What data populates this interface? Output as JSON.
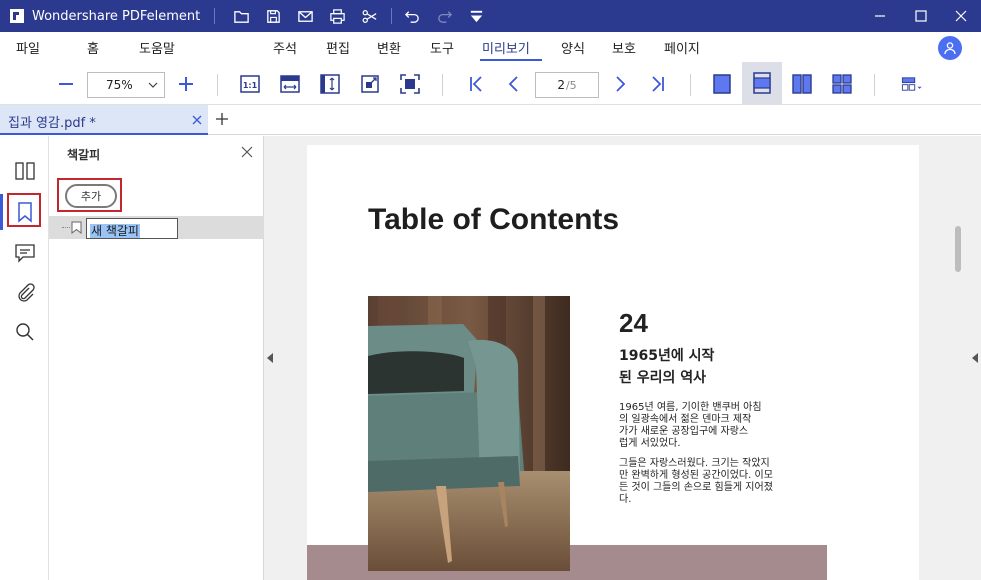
{
  "titlebar": {
    "app_title": "Wondershare PDFelement",
    "quick_actions": [
      "folder-icon",
      "save-icon",
      "mail-icon",
      "print-icon",
      "scissors-icon",
      "undo-icon",
      "redo-icon",
      "dropdown-icon"
    ]
  },
  "menu": {
    "items": [
      "파일",
      "홈",
      "도움말",
      "주석",
      "편집",
      "변환",
      "도구",
      "미리보기",
      "양식",
      "보호",
      "페이지"
    ],
    "active": "미리보기"
  },
  "toolbar": {
    "zoom": "75%",
    "page_current": "2",
    "page_total": "/5"
  },
  "tabs": {
    "document_name": "집과 영감.pdf *"
  },
  "panel": {
    "title": "책갈피",
    "add_label": "추가",
    "bookmark_label": "새 책갈피"
  },
  "page": {
    "title": "Table of Contents",
    "section_number": "24",
    "section_heading_line1": "1965년에 시작",
    "section_heading_line2": "된 우리의 역사",
    "para1": [
      "1965년 여름, 기이한 밴쿠버 아침",
      "의 일광속에서 젊은 덴마크 제작",
      "가가 새로운 공장입구에 자랑스",
      "럽게 서있었다."
    ],
    "para2": [
      "그들은 자랑스러웠다. 크기는 작았지",
      "만 완벽하게 형성된 공간이었다. 이모",
      "든 것이 그들의 손으로 힘들게 지어졌",
      "다."
    ]
  },
  "colors": {
    "titlebar": "#2b3a8f",
    "accent": "#3b59d9",
    "highlight": "#c1272d",
    "pink_band": "#a58a8e"
  }
}
